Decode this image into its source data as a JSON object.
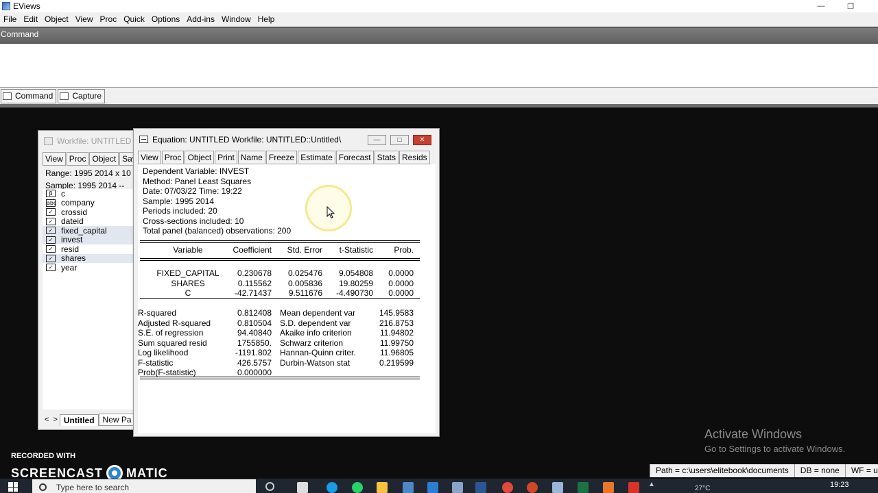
{
  "app": {
    "title": "EViews"
  },
  "menu": [
    "File",
    "Edit",
    "Object",
    "View",
    "Proc",
    "Quick",
    "Options",
    "Add-ins",
    "Window",
    "Help"
  ],
  "command": {
    "header": "Command",
    "tabs": [
      "Command",
      "Capture"
    ]
  },
  "workfile": {
    "title": "Workfile: UNTITLED",
    "toolbar": [
      "View",
      "Proc",
      "Object",
      "Save"
    ],
    "range": "Range:  1995 2014 x 10",
    "sample": "Sample: 1995 2014  --",
    "objects": [
      {
        "name": "c",
        "icon": "coef-icon",
        "glyph": "β"
      },
      {
        "name": "company",
        "icon": "alpha-series-icon",
        "glyph": "abc"
      },
      {
        "name": "crossid",
        "icon": "series-icon",
        "glyph": "✓"
      },
      {
        "name": "dateid",
        "icon": "series-icon",
        "glyph": "✓"
      },
      {
        "name": "fixed_capital",
        "icon": "series-icon",
        "glyph": "✓"
      },
      {
        "name": "invest",
        "icon": "series-icon",
        "glyph": "✓"
      },
      {
        "name": "resid",
        "icon": "series-icon",
        "glyph": "✓"
      },
      {
        "name": "shares",
        "icon": "series-icon",
        "glyph": "✓"
      },
      {
        "name": "year",
        "icon": "series-icon",
        "glyph": "✓"
      }
    ],
    "selected": [
      "fixed_capital",
      "invest",
      "shares"
    ],
    "tabs": [
      "Untitled",
      "New Pa"
    ],
    "nav": [
      "<",
      ">"
    ]
  },
  "equation": {
    "title": "Equation: UNTITLED   Workfile: UNTITLED::Untitled\\",
    "toolbar": [
      "View",
      "Proc",
      "Object",
      "Print",
      "Name",
      "Freeze",
      "Estimate",
      "Forecast",
      "Stats",
      "Resids"
    ],
    "header_lines": [
      "Dependent Variable: INVEST",
      "Method: Panel Least Squares",
      "Date: 07/03/22   Time: 19:22",
      "Sample: 1995 2014",
      "Periods included: 20",
      "Cross-sections included: 10",
      "Total panel (balanced) observations: 200"
    ],
    "columns": [
      "Variable",
      "Coefficient",
      "Std. Error",
      "t-Statistic",
      "Prob."
    ],
    "coefficients": [
      {
        "variable": "FIXED_CAPITAL",
        "coef": "0.230678",
        "se": "0.025476",
        "t": "9.054808",
        "p": "0.0000"
      },
      {
        "variable": "SHARES",
        "coef": "0.115562",
        "se": "0.005836",
        "t": "19.80259",
        "p": "0.0000"
      },
      {
        "variable": "C",
        "coef": "-42.71437",
        "se": "9.511676",
        "t": "-4.490730",
        "p": "0.0000"
      }
    ],
    "stats": [
      {
        "l": "R-squared",
        "lv": "0.812408",
        "r": "Mean dependent var",
        "rv": "145.9583"
      },
      {
        "l": "Adjusted R-squared",
        "lv": "0.810504",
        "r": "S.D. dependent var",
        "rv": "216.8753"
      },
      {
        "l": "S.E. of regression",
        "lv": "94.40840",
        "r": "Akaike info criterion",
        "rv": "11.94802"
      },
      {
        "l": "Sum squared resid",
        "lv": "1755850.",
        "r": "Schwarz criterion",
        "rv": "11.99750"
      },
      {
        "l": "Log likelihood",
        "lv": "-1191.802",
        "r": "Hannan-Quinn criter.",
        "rv": "11.96805"
      },
      {
        "l": "F-statistic",
        "lv": "426.5757",
        "r": "Durbin-Watson stat",
        "rv": "0.219599"
      },
      {
        "l": "Prob(F-statistic)",
        "lv": "0.000000",
        "r": "",
        "rv": ""
      }
    ]
  },
  "watermark": {
    "title": "Activate Windows",
    "subtitle": "Go to Settings to activate Windows.",
    "recorded": "RECORDED WITH",
    "brand_left": "SCREENCAST",
    "brand_right": "MATIC"
  },
  "statusbar": {
    "path": "Path = c:\\users\\elitebook\\documents",
    "db": "DB = none",
    "wf": "WF = untitled"
  },
  "taskbar": {
    "search_placeholder": "Type here to search",
    "weather": "27°C",
    "time": "19:23"
  }
}
